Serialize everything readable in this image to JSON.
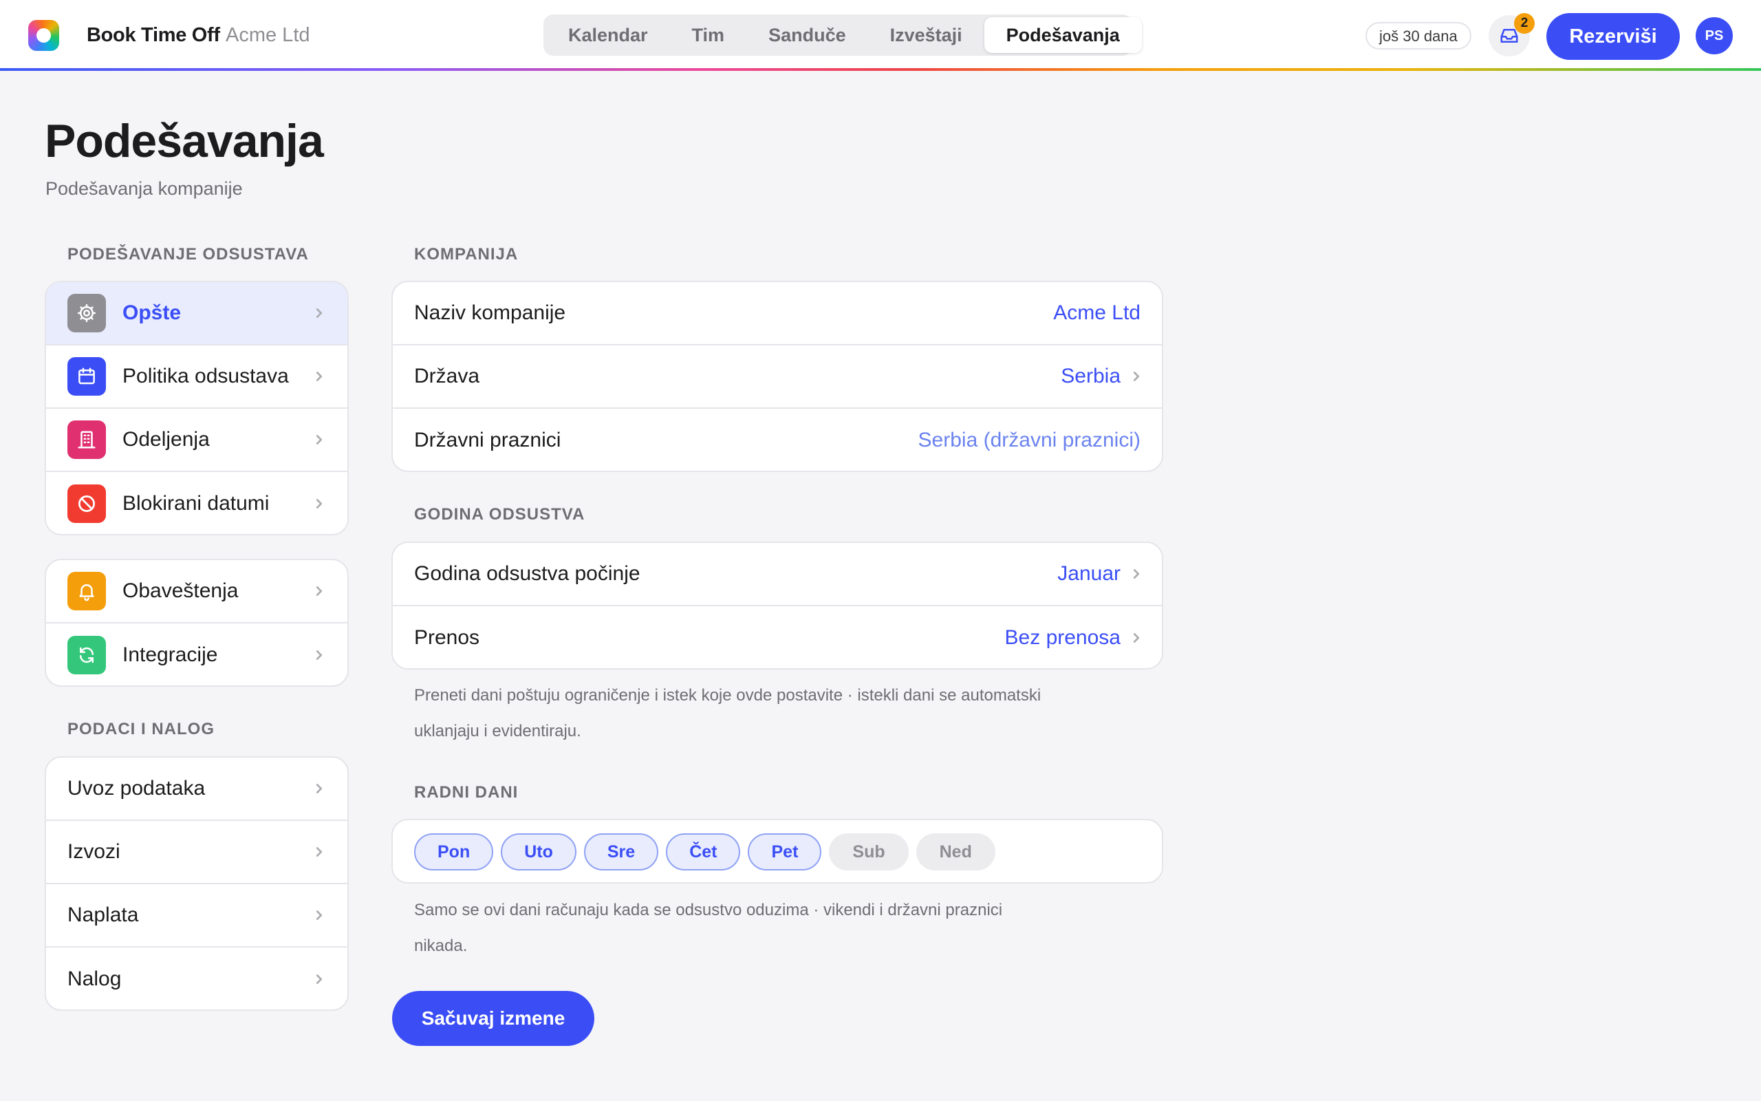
{
  "app": {
    "brand": "Book Time Off",
    "company": "Acme Ltd",
    "accent_color": "#3b4ef6"
  },
  "nav_tabs": [
    {
      "label": "Kalendar",
      "active": false
    },
    {
      "label": "Tim",
      "active": false
    },
    {
      "label": "Sanduče",
      "active": false
    },
    {
      "label": "Izveštaji",
      "active": false
    },
    {
      "label": "Podešavanja",
      "active": true
    }
  ],
  "topbar": {
    "trial_text": "još 30 dana",
    "inbox_count": "2",
    "book_label": "Rezerviši",
    "avatar_initials": "PS"
  },
  "page": {
    "title": "Podešavanja",
    "subtitle": "Podešavanja kompanije"
  },
  "sidebar": {
    "section1_label": "PODEŠAVANJE ODSUSTAVA",
    "group1": [
      {
        "label": "Opšte",
        "icon": "gear-icon",
        "color": "#8e8e93",
        "active": true
      },
      {
        "label": "Politika odsustava",
        "icon": "calendar-icon",
        "color": "#3b4ef6",
        "active": false
      },
      {
        "label": "Odeljenja",
        "icon": "building-icon",
        "color": "#e0306f",
        "active": false
      },
      {
        "label": "Blokirani datumi",
        "icon": "block-icon",
        "color": "#f23b30",
        "active": false
      }
    ],
    "group2": [
      {
        "label": "Obaveštenja",
        "icon": "bell-icon",
        "color": "#f59e0b",
        "active": false
      },
      {
        "label": "Integracije",
        "icon": "sync-icon",
        "color": "#34c77b",
        "active": false
      }
    ],
    "section2_label": "PODACI I NALOG",
    "group3": [
      {
        "label": "Uvoz podataka"
      },
      {
        "label": "Izvozi"
      },
      {
        "label": "Naplata"
      },
      {
        "label": "Nalog"
      }
    ]
  },
  "company": {
    "section_label": "KOMPANIJA",
    "name_label": "Naziv kompanije",
    "name_value": "Acme Ltd",
    "country_label": "Država",
    "country_value": "Serbia",
    "holidays_label": "Državni praznici",
    "holidays_value": "Serbia (državni praznici)"
  },
  "leave_year": {
    "section_label": "GODINA ODSUSTVA",
    "start_label": "Godina odsustva počinje",
    "start_value": "Januar",
    "carryover_label": "Prenos",
    "carryover_value": "Bez prenosa",
    "hint": "Preneti dani poštuju ograničenje i istek koje ovde postavite · istekli dani se automatski uklanjaju i evidentiraju."
  },
  "work_days": {
    "section_label": "RADNI DANI",
    "days": [
      {
        "label": "Pon",
        "on": true
      },
      {
        "label": "Uto",
        "on": true
      },
      {
        "label": "Sre",
        "on": true
      },
      {
        "label": "Čet",
        "on": true
      },
      {
        "label": "Pet",
        "on": true
      },
      {
        "label": "Sub",
        "on": false
      },
      {
        "label": "Ned",
        "on": false
      }
    ],
    "hint": "Samo se ovi dani računaju kada se odsustvo oduzima · vikendi i državni praznici nikada."
  },
  "save_label": "Sačuvaj izmene"
}
